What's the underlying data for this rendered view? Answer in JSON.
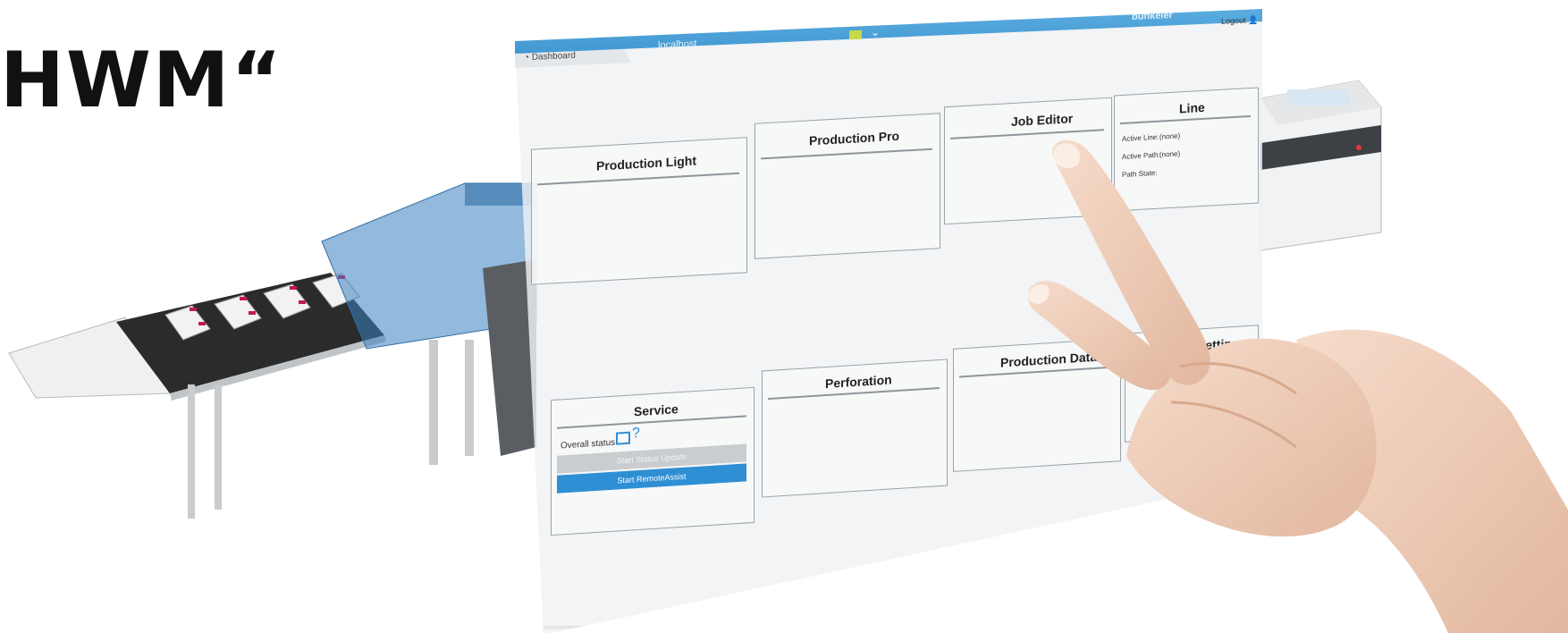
{
  "headline": {
    "text": "HWM“"
  },
  "screen": {
    "dashboard_label": "Dashboard",
    "host_label": "localhost",
    "brand": "bunkeler",
    "logout_label": "Logout",
    "tiles": {
      "production_light": "Production Light",
      "production_pro": "Production Pro",
      "job_editor": "Job Editor",
      "line": "Line",
      "settings": "Settings",
      "production_data": "Production Data",
      "perforation": "Perforation",
      "service": "Service"
    },
    "line": {
      "active_line_label": "Active Line:",
      "active_line_value": "(none)",
      "active_path_label": "Active Path:",
      "active_path_value": "(none)",
      "path_state_label": "Path State:"
    },
    "service": {
      "overall_status_label": "Overall status:",
      "status_icon_text": "?",
      "start_status_update": "Start Status Update",
      "start_remote_assist": "Start RemoteAssist"
    }
  },
  "colors": {
    "accent": "#3d94cf",
    "button_blue": "#2f8fd4",
    "machine_blue": "#2f6fa6"
  }
}
